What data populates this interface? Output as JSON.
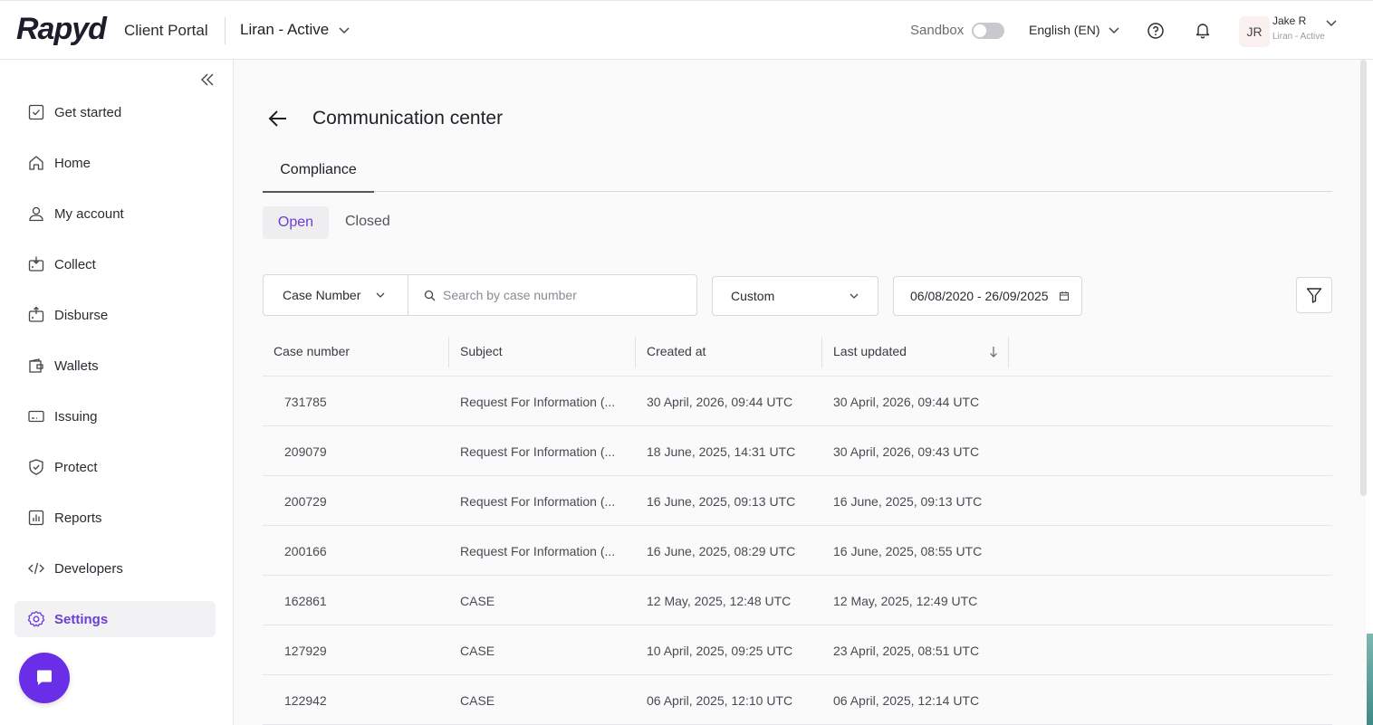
{
  "header": {
    "logo": "Rapyd",
    "portal_label": "Client Portal",
    "account_name": "Liran - Active",
    "sandbox_label": "Sandbox",
    "sandbox_enabled": false,
    "language": "English (EN)",
    "user": {
      "initials": "JR",
      "name": "Jake R",
      "subtitle": "Liran - Active"
    }
  },
  "sidebar": {
    "items": [
      {
        "label": "Get started",
        "icon": "checkbox-icon",
        "active": false
      },
      {
        "label": "Home",
        "icon": "home-icon",
        "active": false
      },
      {
        "label": "My account",
        "icon": "user-icon",
        "active": false
      },
      {
        "label": "Collect",
        "icon": "collect-icon",
        "active": false
      },
      {
        "label": "Disburse",
        "icon": "disburse-icon",
        "active": false
      },
      {
        "label": "Wallets",
        "icon": "wallet-icon",
        "active": false
      },
      {
        "label": "Issuing",
        "icon": "card-icon",
        "active": false
      },
      {
        "label": "Protect",
        "icon": "shield-icon",
        "active": false
      },
      {
        "label": "Reports",
        "icon": "chart-icon",
        "active": false
      },
      {
        "label": "Developers",
        "icon": "code-icon",
        "active": false
      },
      {
        "label": "Settings",
        "icon": "gear-icon",
        "active": true
      }
    ]
  },
  "main": {
    "title": "Communication center",
    "tabs": [
      {
        "label": "Compliance"
      }
    ],
    "segments": {
      "open": "Open",
      "closed": "Closed"
    },
    "filters": {
      "search_type": "Case Number",
      "search_placeholder": "Search by case number",
      "period": "Custom",
      "date_range": "06/08/2020 - 26/09/2025"
    },
    "table": {
      "columns": [
        "Case number",
        "Subject",
        "Created at",
        "Last updated"
      ],
      "rows": [
        {
          "case": "731785",
          "subject": "Request For Information (...",
          "created": "30 April, 2026, 09:44 UTC",
          "updated": "30 April, 2026, 09:44 UTC"
        },
        {
          "case": "209079",
          "subject": "Request For Information (...",
          "created": "18 June, 2025, 14:31 UTC",
          "updated": "30 April, 2026, 09:43 UTC"
        },
        {
          "case": "200729",
          "subject": "Request For Information (...",
          "created": "16 June, 2025, 09:13 UTC",
          "updated": "16 June, 2025, 09:13 UTC"
        },
        {
          "case": "200166",
          "subject": "Request For Information (...",
          "created": "16 June, 2025, 08:29 UTC",
          "updated": "16 June, 2025, 08:55 UTC"
        },
        {
          "case": "162861",
          "subject": "CASE",
          "created": "12 May, 2025, 12:48 UTC",
          "updated": "12 May, 2025, 12:49 UTC"
        },
        {
          "case": "127929",
          "subject": "CASE",
          "created": "10 April, 2025, 09:25 UTC",
          "updated": "23 April, 2025, 08:51 UTC"
        },
        {
          "case": "122942",
          "subject": "CASE",
          "created": "06 April, 2025, 12:10 UTC",
          "updated": "06 April, 2025, 12:14 UTC"
        }
      ]
    }
  },
  "colors": {
    "accent": "#6b3fd4",
    "chat_button": "#6a2ee8"
  }
}
